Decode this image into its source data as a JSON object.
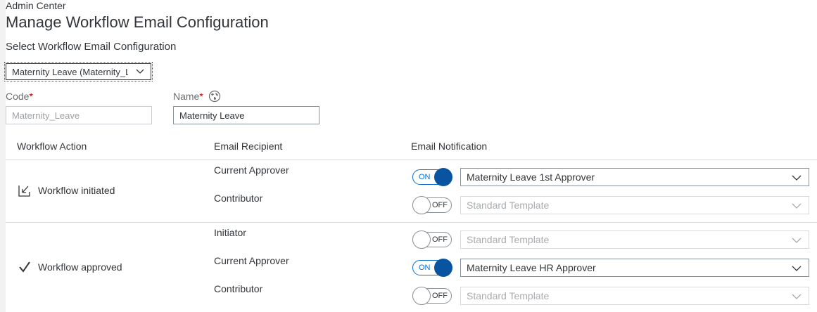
{
  "header": {
    "breadcrumb": "Admin Center",
    "title": "Manage Workflow Email Configuration"
  },
  "config_select": {
    "label": "Select Workflow Email Configuration",
    "value": "Maternity Leave (Maternity_Leave)"
  },
  "code": {
    "label": "Code",
    "required_mark": "*",
    "value": "Maternity_Leave"
  },
  "name": {
    "label": "Name",
    "required_mark": "*",
    "value": "Maternity Leave"
  },
  "table": {
    "headers": [
      "Workflow Action",
      "Email Recipient",
      "Email Notification"
    ],
    "groups": [
      {
        "action": "Workflow initiated",
        "icon": "workflow-initiated-icon",
        "rows": [
          {
            "recipient": "Current Approver",
            "toggle": "ON",
            "template": "Maternity Leave 1st Approver"
          },
          {
            "recipient": "Contributor",
            "toggle": "OFF",
            "template": "Standard Template"
          }
        ]
      },
      {
        "action": "Workflow approved",
        "icon": "checkmark-icon",
        "rows": [
          {
            "recipient": "Initiator",
            "toggle": "OFF",
            "template": "Standard Template"
          },
          {
            "recipient": "Current Approver",
            "toggle": "ON",
            "template": "Maternity Leave HR Approver"
          },
          {
            "recipient": "Contributor",
            "toggle": "OFF",
            "template": "Standard Template"
          }
        ]
      }
    ]
  },
  "colors": {
    "accent": "#0854a0",
    "required": "#bb0000"
  }
}
